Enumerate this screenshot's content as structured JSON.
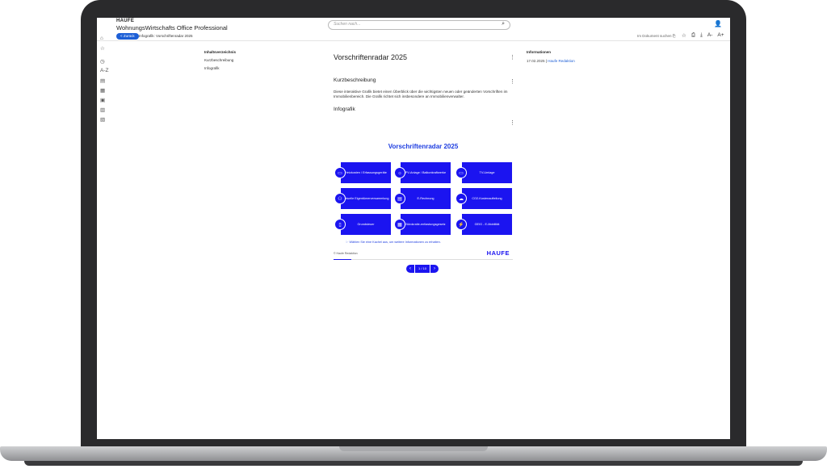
{
  "header": {
    "brand": "HAUFE",
    "product": "WohnungsWirtschafts Office Professional",
    "search_placeholder": "Suchen nach..."
  },
  "subbar": {
    "back_label": "< Zurück",
    "breadcrumb": "Infografik: Vorschriftenradar 2025",
    "doc_search": "Im Dokument suchen"
  },
  "toc": {
    "title": "Inhaltsverzeichnis",
    "items": [
      "Kurzbeschreibung",
      "Infografik"
    ]
  },
  "main": {
    "title": "Vorschriftenradar 2025",
    "sections": {
      "summary_title": "Kurzbeschreibung",
      "summary_text": "Diese interaktive Grafik bietet einen Überblick über die wichtigsten neuen oder geänderten Vorschriften im Immobilienbereich. Die Grafik richtet sich insbesondere an Immobilienverwalter.",
      "graphic_title": "Infografik"
    }
  },
  "info": {
    "title": "Informationen",
    "date": "17.02.2025",
    "separator": "|",
    "author": "Haufe Redaktion"
  },
  "graphic": {
    "title": "Vorschriftenradar 2025",
    "tiles": [
      "Heizkosten / Erfassungsgeräte",
      "PV-Anlage / Balkonkraftwerke",
      "TV-Umlage",
      "Virtuelle Eigentümerversammlung",
      "E-Rechnung",
      "CO2-Kostenaufteilung",
      "Grundsteuer",
      "Bürokratie-entlastungsgesetz",
      "GEIG - E-Mobilität"
    ],
    "hint": "Wählen Sie eine Kachel aus, um weitere Informationen zu erhalten.",
    "credit": "© Haufe Redaktion",
    "logo": "HAUFE",
    "progress": 0.1,
    "pager": "1 / 10"
  }
}
